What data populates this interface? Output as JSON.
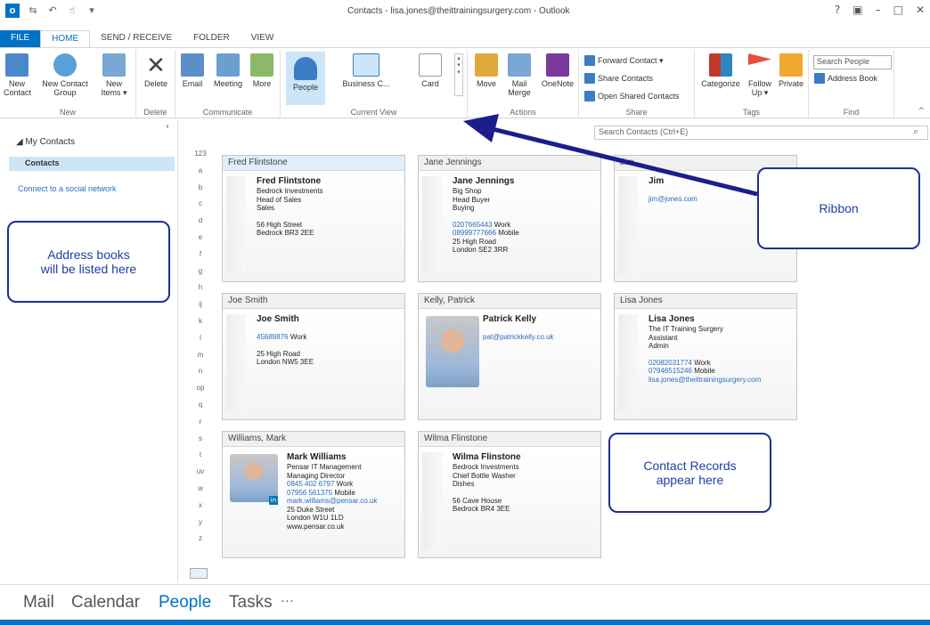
{
  "window": {
    "title": "Contacts - lisa.jones@theittrainingsurgery.com - Outlook",
    "app_icon": "O",
    "controls": [
      "?",
      "▣",
      "–",
      "□",
      "✕"
    ]
  },
  "tabs": [
    "FILE",
    "HOME",
    "SEND / RECEIVE",
    "FOLDER",
    "VIEW"
  ],
  "ribbon": {
    "new": {
      "label": "New",
      "new_contact": "New\nContact",
      "new_contact_group": "New Contact\nGroup",
      "new_items": "New\nItems ▾"
    },
    "delete": {
      "label": "Delete",
      "button": "Delete"
    },
    "communicate": {
      "label": "Communicate",
      "email": "Email",
      "meeting": "Meeting",
      "more": "More"
    },
    "current_view": {
      "label": "Current View",
      "people": "People",
      "business_card": "Business C...",
      "card": "Card"
    },
    "actions": {
      "label": "Actions",
      "move": "Move",
      "mail_merge": "Mail\nMerge",
      "onenote": "OneNote"
    },
    "share": {
      "label": "Share",
      "forward_contact": "Forward Contact ▾",
      "share_contacts": "Share Contacts",
      "open_shared": "Open Shared Contacts"
    },
    "tags": {
      "label": "Tags",
      "categorize": "Categorize",
      "follow_up": "Follow\nUp ▾",
      "private": "Private"
    },
    "find": {
      "label": "Find",
      "search_people": "Search People",
      "address_book": "Address Book"
    }
  },
  "sidebar": {
    "header": "◢ My Contacts",
    "selected": "Contacts",
    "social_link": "Connect to a social network"
  },
  "search": {
    "placeholder": "Search Contacts (Ctrl+E)"
  },
  "alpha_index": [
    "123",
    "a",
    "b",
    "c",
    "d",
    "e",
    "f",
    "g",
    "h",
    "ij",
    "k",
    "l",
    "m",
    "n",
    "op",
    "q",
    "r",
    "s",
    "t",
    "uv",
    "w",
    "x",
    "y",
    "z"
  ],
  "callouts": {
    "ribbon": "Ribbon",
    "address_books": "Address books\nwill be listed here",
    "contact_records": "Contact Records\nappear here"
  },
  "cards": [
    {
      "header": "Fred Flintstone",
      "name": "Fred Flintstone",
      "lines": [
        "Bedrock Investments",
        "Head of Sales",
        "Sales",
        "",
        "56 High Street",
        "Bedrock BR3 2EE"
      ],
      "links": []
    },
    {
      "header": "Jane Jennings",
      "name": "Jane Jennings",
      "lines": [
        "Big Shop",
        "Head Buyer",
        "Buying"
      ],
      "phones": [
        {
          "num": "0207665443",
          "type": "Work"
        },
        {
          "num": "08999777666",
          "type": "Mobile"
        }
      ],
      "address": [
        "25 High Road",
        "London SE2 3RR"
      ]
    },
    {
      "header": "Jim",
      "name": "Jim",
      "email": "jim@jones.com"
    },
    {
      "header": "Joe Smith",
      "name": "Joe Smith",
      "phones": [
        {
          "num": "45689876",
          "type": "Work"
        }
      ],
      "address": [
        "25 High Road",
        "London NW5 3EE"
      ]
    },
    {
      "header": "Kelly, Patrick",
      "name": "Patrick Kelly",
      "email": "pat@patrickkelly.co.uk"
    },
    {
      "header": "Lisa Jones",
      "name": "Lisa Jones",
      "lines": [
        "The IT Training Surgery",
        "Assistant",
        "Admin"
      ],
      "phones": [
        {
          "num": "02082031774",
          "type": "Work"
        },
        {
          "num": "07946515246",
          "type": "Mobile"
        }
      ],
      "email": "lisa.jones@theittrainingsurgery.com"
    },
    {
      "header": "Williams, Mark",
      "name": "Mark Williams",
      "lines": [
        "Pensar IT Management",
        "Managing Director"
      ],
      "phones": [
        {
          "num": "0845 402 6797",
          "type": "Work"
        },
        {
          "num": "07956 561375",
          "type": "Mobile"
        }
      ],
      "email": "mark.williams@pensar.co.uk",
      "address": [
        "25 Duke Street",
        "London W1U 1LD",
        "www.pensar.co.uk"
      ]
    },
    {
      "header": "Wilma Flinstone",
      "name": "Wilma Flinstone",
      "lines": [
        "Bedrock Investments",
        "Chief Bottle Washer",
        "Dishes",
        "",
        "56 Cave House",
        "Bedrock BR4 3EE"
      ]
    }
  ],
  "bottom_nav": {
    "mail": "Mail",
    "calendar": "Calendar",
    "people": "People",
    "tasks": "Tasks",
    "more": "···"
  },
  "colors": {
    "accent": "#0072c6",
    "callout_border": "#1f2f8f",
    "link": "#2a6ebb"
  }
}
